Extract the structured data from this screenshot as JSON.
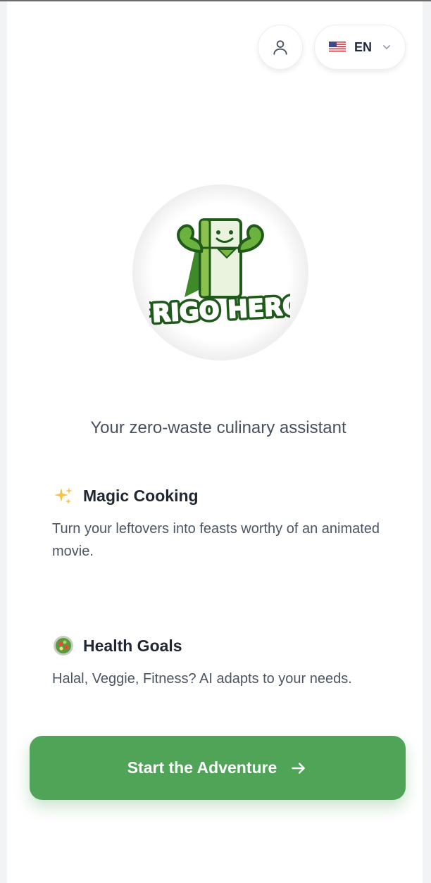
{
  "header": {
    "language": {
      "code": "EN",
      "flag_icon": "us-flag-icon"
    },
    "account_icon": "user-icon"
  },
  "logo": {
    "text": "FRIGO HERO"
  },
  "tagline": "Your zero-waste culinary assistant",
  "features": [
    {
      "icon": "sparkles-icon",
      "title": "Magic Cooking",
      "description": "Turn your leftovers into feasts worthy of an animated movie."
    },
    {
      "icon": "salad-bowl-icon",
      "title": "Health Goals",
      "description": "Halal, Veggie, Fitness? AI adapts to your needs."
    }
  ],
  "cta": {
    "label": "Start the Adventure"
  },
  "colors": {
    "brand_green": "#4fa457",
    "logo_green": "#5ea83a",
    "logo_dark": "#1f5a1b"
  }
}
